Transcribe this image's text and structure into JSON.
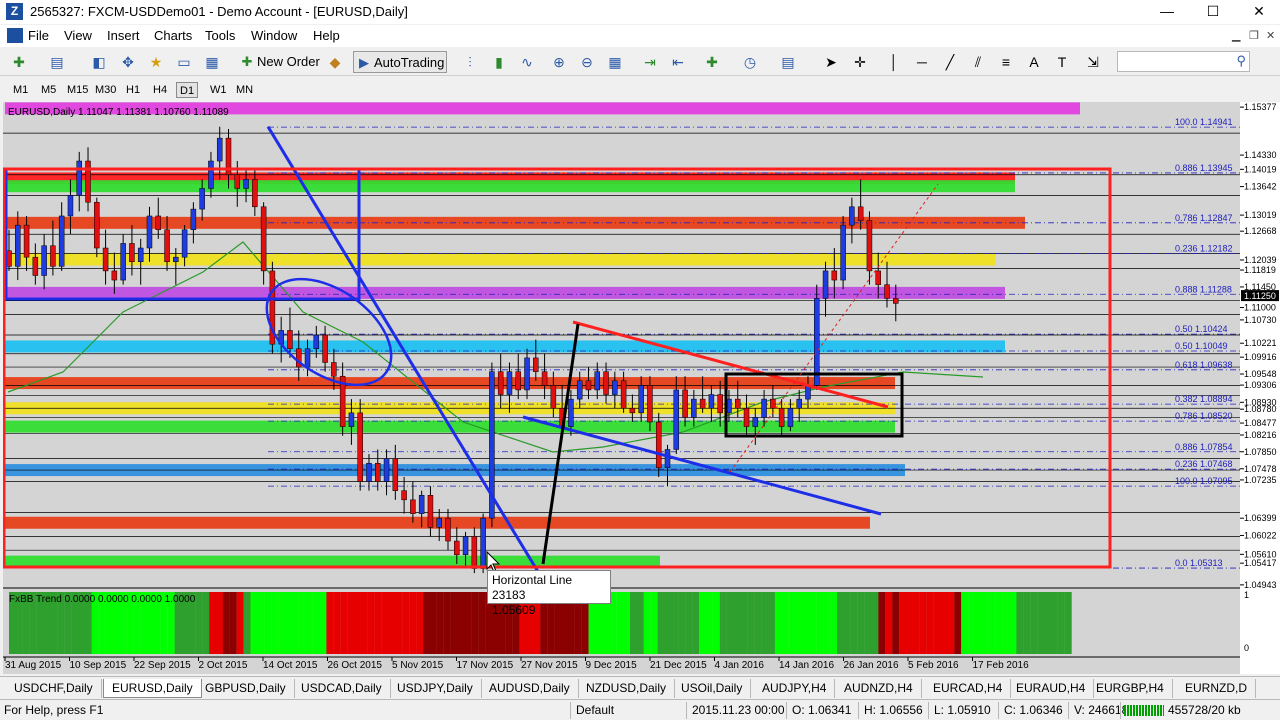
{
  "window": {
    "title": "2565327: FXCM-USDDemo01 - Demo Account - [EURUSD,Daily]",
    "minimize": "—",
    "maximize": "☐",
    "close": "✕"
  },
  "menu": [
    "File",
    "View",
    "Insert",
    "Charts",
    "Tools",
    "Window",
    "Help"
  ],
  "toolbar": {
    "new_order": "New Order",
    "autotrading": "AutoTrading"
  },
  "timeframes": [
    "M1",
    "M5",
    "M15",
    "M30",
    "H1",
    "H4",
    "D1",
    "W1",
    "MN"
  ],
  "timeframe_active": "D1",
  "chart": {
    "symbol_line": "EURUSD,Daily  1.11047 1.11381 1.10760 1.11089",
    "indicator_label": "FxBB Trend 0.0000 0.0000 0.0000 1.0000",
    "price_labels": [
      "1.15377",
      "1.14330",
      "1.14019",
      "1.13642",
      "1.13019",
      "1.12668",
      "1.12039",
      "1.11819",
      "1.11450",
      "1.11250",
      "1.11000",
      "1.10730",
      "1.10221",
      "1.09916",
      "1.09548",
      "1.09306",
      "1.08930",
      "1.08780",
      "1.08477",
      "1.08216",
      "1.07850",
      "1.07478",
      "1.07235",
      "1.06399",
      "1.06022",
      "1.05610",
      "1.05417",
      "1.04943"
    ],
    "current_price": "1.11250",
    "fib_labels": [
      "100.0  1.14941",
      "0.886  1.13945",
      "0.786  1.12847",
      "0.236  1.12182",
      "0.888  1.11288",
      "0.50  1.10424",
      "0.50  1.10049",
      "0.618  1.09638",
      "0.382  1.08894",
      "0.786  1.08520",
      "0.886  1.07854",
      "0.236  1.07468",
      "100.0  1.07095",
      "0.0  1.05313"
    ],
    "dates": [
      "31 Aug 2015",
      "10 Sep 2015",
      "22 Sep 2015",
      "2 Oct 2015",
      "14 Oct 2015",
      "26 Oct 2015",
      "5 Nov 2015",
      "17 Nov 2015",
      "27 Nov 2015",
      "9 Dec 2015",
      "21 Dec 2015",
      "4 Jan 2016",
      "14 Jan 2016",
      "26 Jan 2016",
      "5 Feb 2016",
      "17 Feb 2016"
    ],
    "ind_scale": [
      "1",
      "0"
    ],
    "tooltip_title": "Horizontal Line 23183",
    "tooltip_value": "1.05609"
  },
  "tabs": [
    "USDCHF,Daily",
    "EURUSD,Daily",
    "GBPUSD,Daily",
    "USDCAD,Daily",
    "USDJPY,Daily",
    "AUDUSD,Daily",
    "NZDUSD,Daily",
    "USOil,Daily",
    "AUDJPY,H4",
    "AUDNZD,H4",
    "EURCAD,H4",
    "EURAUD,H4",
    "EURGBP,H4",
    "EURNZD,D"
  ],
  "active_tab": "EURUSD,Daily",
  "status": {
    "help": "For Help, press F1",
    "profile": "Default",
    "datetime": "2015.11.23 00:00",
    "open": "O: 1.06341",
    "high": "H: 1.06556",
    "low": "L: 1.05910",
    "close": "C: 1.06346",
    "volume": "V: 246618",
    "traffic": "455728/20 kb"
  },
  "candles": [
    [
      1.1224,
      1.127,
      1.118,
      1.119
    ],
    [
      1.119,
      1.131,
      1.116,
      1.128
    ],
    [
      1.128,
      1.13,
      1.118,
      1.121
    ],
    [
      1.121,
      1.124,
      1.115,
      1.117
    ],
    [
      1.117,
      1.126,
      1.114,
      1.1235
    ],
    [
      1.1235,
      1.129,
      1.117,
      1.119
    ],
    [
      1.119,
      1.133,
      1.118,
      1.13
    ],
    [
      1.13,
      1.138,
      1.126,
      1.1345
    ],
    [
      1.1345,
      1.144,
      1.131,
      1.142
    ],
    [
      1.142,
      1.145,
      1.131,
      1.133
    ],
    [
      1.133,
      1.134,
      1.121,
      1.123
    ],
    [
      1.123,
      1.127,
      1.115,
      1.118
    ],
    [
      1.118,
      1.122,
      1.113,
      1.116
    ],
    [
      1.116,
      1.126,
      1.115,
      1.124
    ],
    [
      1.124,
      1.128,
      1.117,
      1.12
    ],
    [
      1.12,
      1.125,
      1.115,
      1.123
    ],
    [
      1.123,
      1.132,
      1.12,
      1.13
    ],
    [
      1.13,
      1.134,
      1.125,
      1.127
    ],
    [
      1.127,
      1.13,
      1.118,
      1.12
    ],
    [
      1.12,
      1.123,
      1.115,
      1.121
    ],
    [
      1.121,
      1.128,
      1.119,
      1.127
    ],
    [
      1.127,
      1.133,
      1.124,
      1.1315
    ],
    [
      1.1315,
      1.138,
      1.129,
      1.136
    ],
    [
      1.136,
      1.144,
      1.134,
      1.142
    ],
    [
      1.142,
      1.1495,
      1.138,
      1.147
    ],
    [
      1.147,
      1.149,
      1.136,
      1.139
    ],
    [
      1.139,
      1.142,
      1.132,
      1.136
    ],
    [
      1.136,
      1.14,
      1.133,
      1.138
    ],
    [
      1.138,
      1.14,
      1.13,
      1.132
    ],
    [
      1.132,
      1.133,
      1.115,
      1.118
    ],
    [
      1.118,
      1.12,
      1.1,
      1.102
    ],
    [
      1.102,
      1.108,
      1.098,
      1.105
    ],
    [
      1.105,
      1.11,
      1.099,
      1.101
    ],
    [
      1.101,
      1.105,
      1.094,
      1.097
    ],
    [
      1.097,
      1.103,
      1.095,
      1.101
    ],
    [
      1.101,
      1.106,
      1.099,
      1.104
    ],
    [
      1.104,
      1.106,
      1.096,
      1.098
    ],
    [
      1.098,
      1.101,
      1.092,
      1.095
    ],
    [
      1.095,
      1.098,
      1.082,
      1.084
    ],
    [
      1.084,
      1.09,
      1.08,
      1.087
    ],
    [
      1.087,
      1.09,
      1.07,
      1.072
    ],
    [
      1.072,
      1.078,
      1.07,
      1.076
    ],
    [
      1.076,
      1.079,
      1.07,
      1.072
    ],
    [
      1.072,
      1.079,
      1.069,
      1.077
    ],
    [
      1.077,
      1.08,
      1.068,
      1.07
    ],
    [
      1.07,
      1.073,
      1.065,
      1.068
    ],
    [
      1.068,
      1.072,
      1.063,
      1.065
    ],
    [
      1.065,
      1.07,
      1.062,
      1.069
    ],
    [
      1.069,
      1.071,
      1.06,
      1.062
    ],
    [
      1.062,
      1.066,
      1.059,
      1.064
    ],
    [
      1.064,
      1.066,
      1.057,
      1.059
    ],
    [
      1.059,
      1.062,
      1.054,
      1.056
    ],
    [
      1.056,
      1.061,
      1.053,
      1.06
    ],
    [
      1.06,
      1.062,
      1.052,
      1.053
    ],
    [
      1.053,
      1.065,
      1.052,
      1.064
    ],
    [
      1.064,
      1.098,
      1.062,
      1.096
    ],
    [
      1.096,
      1.1,
      1.088,
      1.091
    ],
    [
      1.091,
      1.098,
      1.087,
      1.096
    ],
    [
      1.096,
      1.1,
      1.09,
      1.092
    ],
    [
      1.092,
      1.101,
      1.09,
      1.099
    ],
    [
      1.099,
      1.103,
      1.094,
      1.096
    ],
    [
      1.096,
      1.1,
      1.09,
      1.093
    ],
    [
      1.093,
      1.096,
      1.086,
      1.088
    ],
    [
      1.088,
      1.093,
      1.082,
      1.084
    ],
    [
      1.084,
      1.092,
      1.082,
      1.09
    ],
    [
      1.09,
      1.096,
      1.088,
      1.094
    ],
    [
      1.094,
      1.097,
      1.09,
      1.092
    ],
    [
      1.092,
      1.098,
      1.09,
      1.096
    ],
    [
      1.096,
      1.098,
      1.089,
      1.091
    ],
    [
      1.091,
      1.096,
      1.088,
      1.094
    ],
    [
      1.094,
      1.096,
      1.087,
      1.088
    ],
    [
      1.088,
      1.091,
      1.085,
      1.087
    ],
    [
      1.087,
      1.095,
      1.085,
      1.093
    ],
    [
      1.093,
      1.095,
      1.083,
      1.085
    ],
    [
      1.085,
      1.087,
      1.073,
      1.075
    ],
    [
      1.075,
      1.08,
      1.071,
      1.079
    ],
    [
      1.079,
      1.095,
      1.078,
      1.092
    ],
    [
      1.092,
      1.095,
      1.084,
      1.086
    ],
    [
      1.086,
      1.092,
      1.084,
      1.09
    ],
    [
      1.09,
      1.095,
      1.087,
      1.088
    ],
    [
      1.088,
      1.093,
      1.085,
      1.091
    ],
    [
      1.091,
      1.094,
      1.084,
      1.087
    ],
    [
      1.087,
      1.092,
      1.085,
      1.09
    ],
    [
      1.09,
      1.094,
      1.086,
      1.088
    ],
    [
      1.088,
      1.091,
      1.082,
      1.084
    ],
    [
      1.084,
      1.088,
      1.08,
      1.086
    ],
    [
      1.086,
      1.092,
      1.084,
      1.09
    ],
    [
      1.09,
      1.093,
      1.086,
      1.088
    ],
    [
      1.088,
      1.09,
      1.082,
      1.084
    ],
    [
      1.084,
      1.09,
      1.083,
      1.088
    ],
    [
      1.088,
      1.092,
      1.085,
      1.09
    ],
    [
      1.09,
      1.095,
      1.088,
      1.093
    ],
    [
      1.093,
      1.115,
      1.092,
      1.112
    ],
    [
      1.112,
      1.12,
      1.108,
      1.118
    ],
    [
      1.118,
      1.123,
      1.112,
      1.116
    ],
    [
      1.116,
      1.13,
      1.114,
      1.128
    ],
    [
      1.128,
      1.134,
      1.124,
      1.132
    ],
    [
      1.132,
      1.138,
      1.127,
      1.129
    ],
    [
      1.129,
      1.131,
      1.115,
      1.118
    ],
    [
      1.118,
      1.122,
      1.112,
      1.115
    ],
    [
      1.115,
      1.12,
      1.11,
      1.112
    ],
    [
      1.112,
      1.115,
      1.107,
      1.1109
    ]
  ],
  "indicator_colors": [
    "#2ea02e",
    "#2ea02e",
    "#2ea02e",
    "#2ea02e",
    "#2ea02e",
    "#2ea02e",
    "#2ea02e",
    "#2ea02e",
    "#2ea02e",
    "#2ea02e",
    "#2ea02e",
    "#2ea02e",
    "#00ff00",
    "#00ff00",
    "#00ff00",
    "#00ff00",
    "#00ff00",
    "#00ff00",
    "#00ff00",
    "#00ff00",
    "#00ff00",
    "#00ff00",
    "#00ff00",
    "#00ff00",
    "#2ea02e",
    "#2ea02e",
    "#2ea02e",
    "#2ea02e",
    "#2ea02e",
    "#e60000",
    "#e60000",
    "#8b0000",
    "#8b0000",
    "#e60000",
    "#2ea02e",
    "#00ff00",
    "#00ff00",
    "#00ff00",
    "#00ff00",
    "#00ff00",
    "#00ff00",
    "#00ff00",
    "#00ff00",
    "#00ff00",
    "#00ff00",
    "#00ff00",
    "#e60000",
    "#e60000",
    "#e60000",
    "#e60000",
    "#e60000",
    "#e60000",
    "#e60000",
    "#e60000",
    "#e60000",
    "#e60000",
    "#e60000",
    "#e60000",
    "#e60000",
    "#e60000",
    "#8b0000",
    "#8b0000",
    "#8b0000",
    "#8b0000",
    "#8b0000",
    "#8b0000",
    "#8b0000",
    "#8b0000",
    "#8b0000",
    "#8b0000",
    "#8b0000",
    "#8b0000",
    "#8b0000",
    "#8b0000",
    "#e60000",
    "#e60000",
    "#e60000",
    "#8b0000",
    "#8b0000",
    "#8b0000",
    "#8b0000",
    "#8b0000",
    "#8b0000",
    "#8b0000",
    "#00ff00",
    "#00ff00",
    "#00ff00",
    "#00ff00",
    "#00ff00",
    "#00ff00",
    "#2ea02e",
    "#2ea02e",
    "#00ff00",
    "#00ff00",
    "#2ea02e",
    "#2ea02e",
    "#2ea02e",
    "#2ea02e",
    "#2ea02e",
    "#2ea02e",
    "#00ff00",
    "#00ff00",
    "#00ff00",
    "#2ea02e",
    "#2ea02e",
    "#2ea02e",
    "#2ea02e",
    "#2ea02e",
    "#2ea02e",
    "#2ea02e",
    "#2ea02e",
    "#00ff00",
    "#00ff00",
    "#00ff00",
    "#00ff00",
    "#00ff00",
    "#00ff00",
    "#00ff00",
    "#00ff00",
    "#00ff00",
    "#2ea02e",
    "#2ea02e",
    "#2ea02e",
    "#2ea02e",
    "#2ea02e",
    "#2ea02e",
    "#8b0000",
    "#e60000",
    "#8b0000",
    "#e60000",
    "#e60000",
    "#e60000",
    "#e60000",
    "#e60000",
    "#e60000",
    "#e60000",
    "#e60000",
    "#8b0000",
    "#00ff00",
    "#00ff00",
    "#00ff00",
    "#00ff00",
    "#00ff00",
    "#00ff00",
    "#00ff00",
    "#00ff00",
    "#2ea02e",
    "#2ea02e",
    "#2ea02e",
    "#2ea02e",
    "#2ea02e",
    "#2ea02e",
    "#2ea02e",
    "#2ea02e"
  ],
  "zones": [
    {
      "price": 1.1535,
      "color": "#e040e0"
    },
    {
      "price": 1.1382,
      "color": "#ff2020"
    },
    {
      "price": 1.1365,
      "color": "#33dd33"
    },
    {
      "price": 1.1285,
      "color": "#e8401a"
    },
    {
      "price": 1.1205,
      "color": "#f0e020"
    },
    {
      "price": 1.1132,
      "color": "#c050e0"
    },
    {
      "price": 1.1015,
      "color": "#20c0f0"
    },
    {
      "price": 1.0935,
      "color": "#e8401a"
    },
    {
      "price": 1.088,
      "color": "#f0e020"
    },
    {
      "price": 1.084,
      "color": "#33dd33"
    },
    {
      "price": 1.0745,
      "color": "#3090e0"
    },
    {
      "price": 1.063,
      "color": "#e8401a"
    },
    {
      "price": 1.0545,
      "color": "#33dd33"
    }
  ]
}
